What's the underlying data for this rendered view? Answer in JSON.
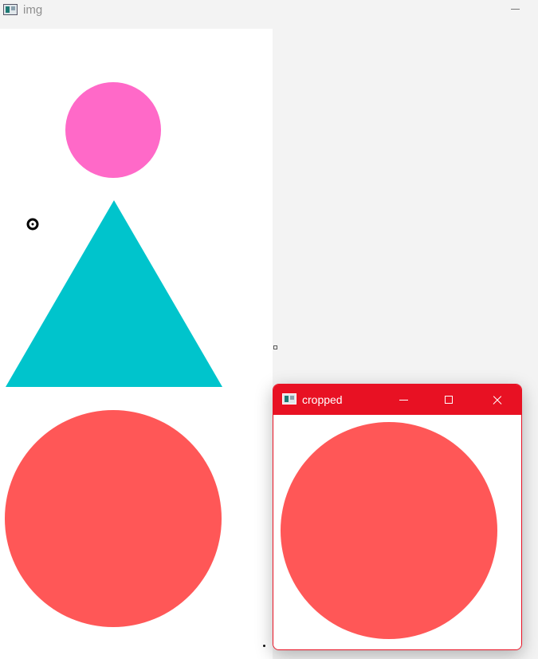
{
  "main_window": {
    "title": "img",
    "icon": "app-window-icon",
    "buttons": {
      "minimize": "minimize-icon"
    }
  },
  "image_canvas": {
    "shapes": [
      {
        "shape": "circle",
        "color": "#ff69c8"
      },
      {
        "shape": "triangle",
        "color": "#00c4cc"
      },
      {
        "shape": "circle",
        "color": "#ff5757"
      }
    ],
    "cursor": "crosshair-cursor-icon"
  },
  "cropped_window": {
    "title": "cropped",
    "accent_color": "#e81123",
    "icon": "app-window-icon",
    "buttons": {
      "minimize": "minimize-icon",
      "maximize": "maximize-icon",
      "close": "close-icon"
    },
    "content_shape": {
      "shape": "circle",
      "color": "#ff5757"
    }
  }
}
